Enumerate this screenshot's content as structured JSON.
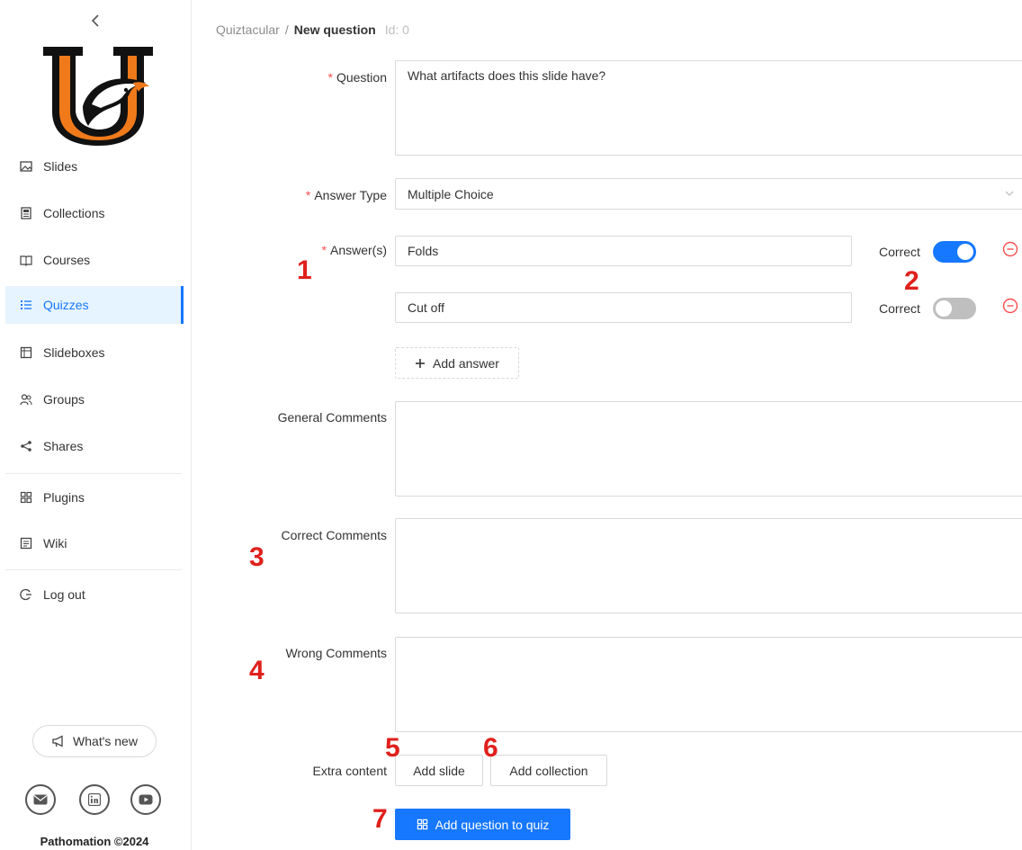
{
  "sidebar": {
    "items": [
      {
        "label": "Slides",
        "icon": "image-icon"
      },
      {
        "label": "Collections",
        "icon": "collection-icon"
      },
      {
        "label": "Courses",
        "icon": "book-icon"
      },
      {
        "label": "Quizzes",
        "icon": "list-icon"
      },
      {
        "label": "Slideboxes",
        "icon": "box-icon"
      },
      {
        "label": "Groups",
        "icon": "users-icon"
      },
      {
        "label": "Shares",
        "icon": "share-icon"
      },
      {
        "label": "Plugins",
        "icon": "plugin-icon"
      },
      {
        "label": "Wiki",
        "icon": "wiki-icon"
      },
      {
        "label": "Log out",
        "icon": "logout-icon"
      }
    ],
    "active_item": "Quizzes",
    "whats_new_label": "What's new",
    "copyright": "Pathomation ©2024",
    "accent_color": "#1677ff"
  },
  "breadcrumb": {
    "root": "Quiztacular",
    "separator": "/",
    "current": "New question",
    "id_text": "Id: 0"
  },
  "form": {
    "question_label": "Question",
    "question_value": "What artifacts does this slide have?",
    "answer_type_label": "Answer Type",
    "answer_type_value": "Multiple Choice",
    "answers_label": "Answer(s)",
    "answers": [
      {
        "value": "Folds",
        "correct_label": "Correct",
        "correct": true
      },
      {
        "value": "Cut off",
        "correct_label": "Correct",
        "correct": false
      }
    ],
    "add_answer_label": "Add answer",
    "general_comments_label": "General Comments",
    "correct_comments_label": "Correct Comments",
    "wrong_comments_label": "Wrong Comments",
    "extra_content_label": "Extra content",
    "add_slide_label": "Add slide",
    "add_collection_label": "Add collection",
    "submit_label": "Add question to quiz"
  },
  "annotations": [
    "1",
    "2",
    "3",
    "4",
    "5",
    "6",
    "7"
  ],
  "annotation_color": "#e0201c"
}
